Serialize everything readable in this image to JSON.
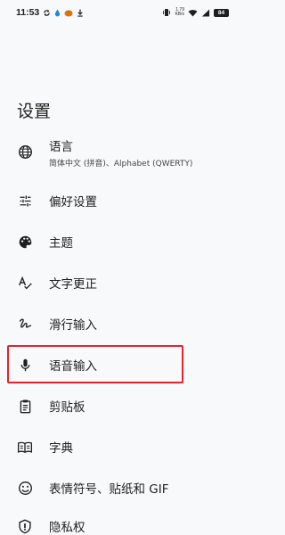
{
  "status_bar": {
    "time": "11:53",
    "net_speed_value": "1.79",
    "net_speed_unit": "KB/s",
    "battery": "84"
  },
  "page": {
    "title": "设置"
  },
  "items": [
    {
      "label": "语言",
      "sub": "简体中文 (拼音)、Alphabet (QWERTY)",
      "icon": "globe-icon"
    },
    {
      "label": "偏好设置",
      "icon": "sliders-icon"
    },
    {
      "label": "主题",
      "icon": "palette-icon"
    },
    {
      "label": "文字更正",
      "icon": "spellcheck-icon"
    },
    {
      "label": "滑行输入",
      "icon": "gesture-icon"
    },
    {
      "label": "语音输入",
      "icon": "mic-icon"
    },
    {
      "label": "剪贴板",
      "icon": "clipboard-icon"
    },
    {
      "label": "字典",
      "icon": "dictionary-icon"
    },
    {
      "label": "表情符号、贴纸和 GIF",
      "icon": "emoji-icon"
    },
    {
      "label": "隐私权",
      "icon": "shield-icon"
    }
  ],
  "colors": {
    "highlight": "#e8212b",
    "background": "#f8f9fa",
    "text": "#1f1f1f"
  }
}
